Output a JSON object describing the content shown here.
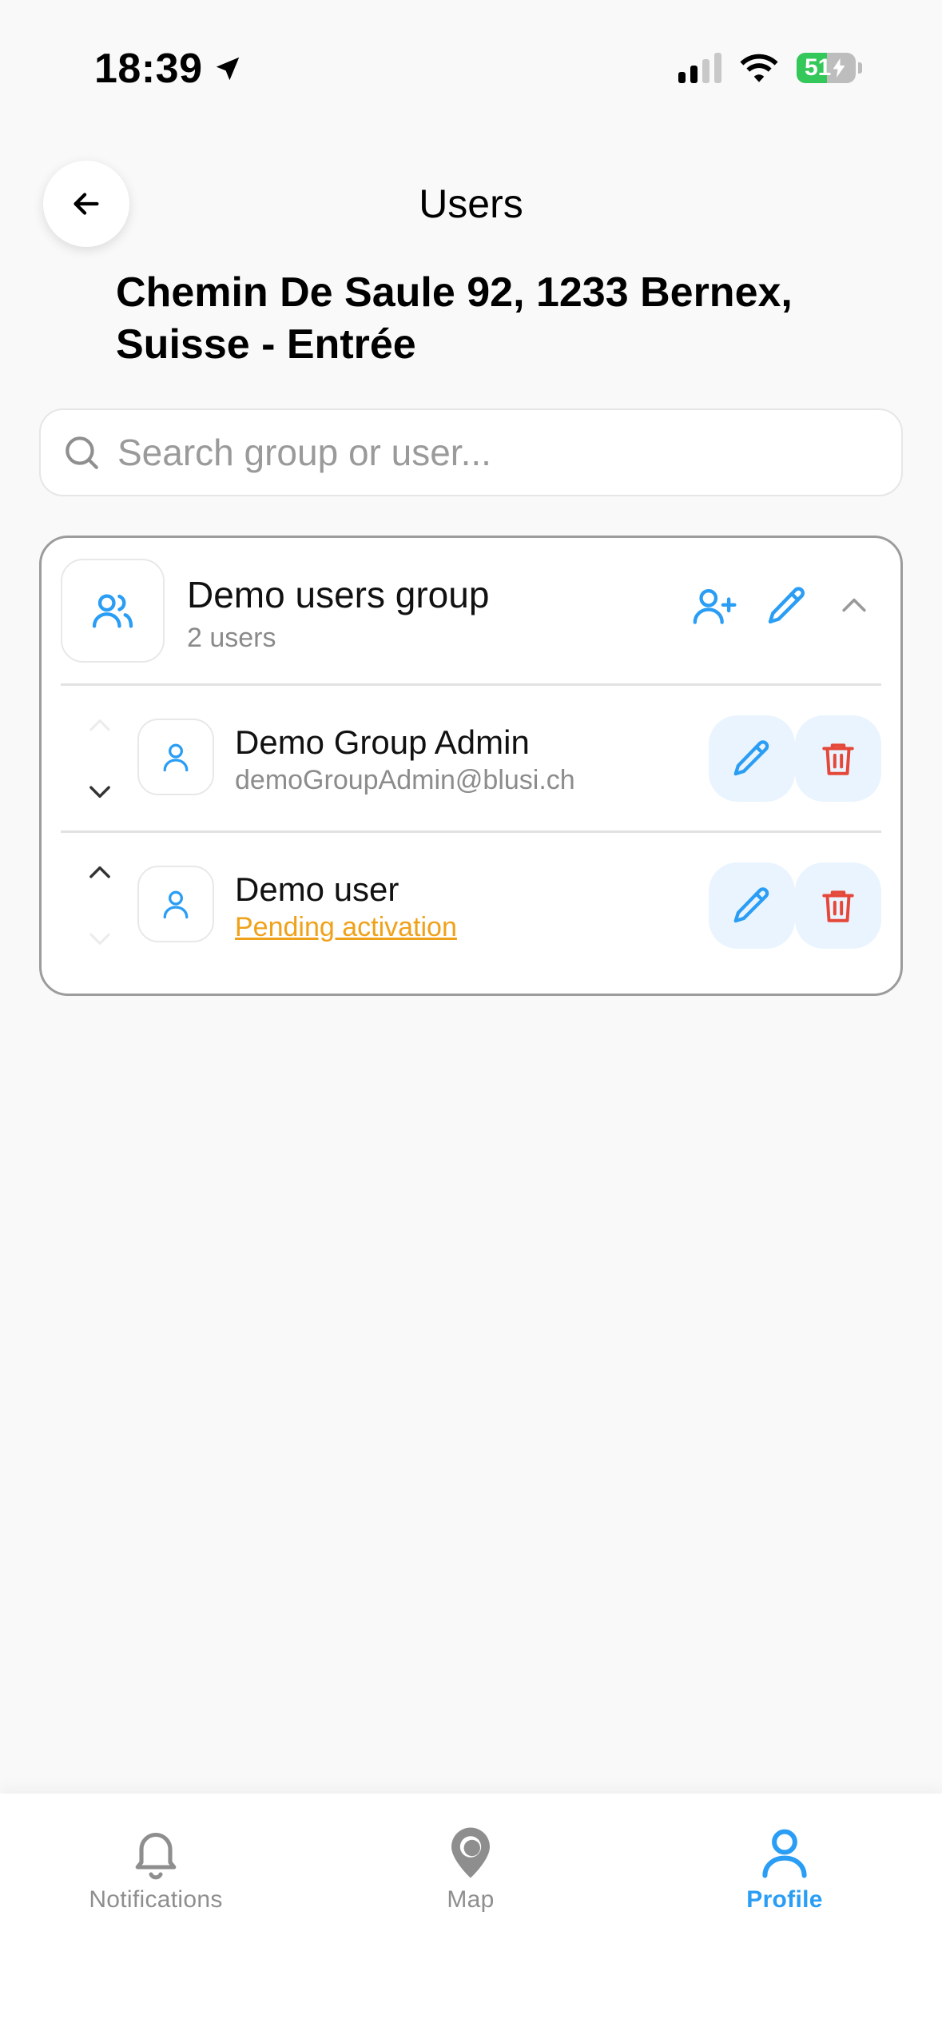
{
  "status": {
    "time": "18:39",
    "battery": "51"
  },
  "header": {
    "title": "Users",
    "address": "Chemin De Saule 92, 1233 Bernex, Suisse - Entrée"
  },
  "search": {
    "placeholder": "Search group or user..."
  },
  "group": {
    "name": "Demo users group",
    "count": "2 users",
    "users": [
      {
        "name": "Demo Group Admin",
        "sub": "demoGroupAdmin@blusi.ch"
      },
      {
        "name": "Demo user",
        "sub": "Pending activation"
      }
    ]
  },
  "tabs": [
    {
      "label": "Notifications",
      "icon": "bell-icon"
    },
    {
      "label": "Map",
      "icon": "map-pin-icon"
    },
    {
      "label": "Profile",
      "icon": "user-icon"
    }
  ],
  "colors": {
    "accent": "#2a9df4",
    "danger": "#e5483a",
    "pending": "#f0a11a",
    "battery": "#34c759"
  }
}
